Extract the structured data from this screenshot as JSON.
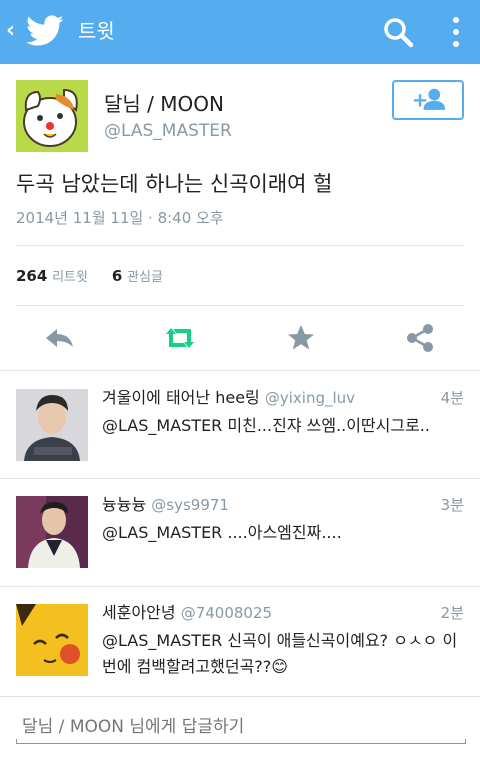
{
  "topbar": {
    "title": "트윗",
    "back_icon": "chevron-left-icon",
    "logo_icon": "twitter-bird-icon",
    "search_icon": "search-icon",
    "more_icon": "more-vertical-icon",
    "color": "#55acee"
  },
  "tweet": {
    "author_name": "달님 / MOON",
    "author_handle": "@LAS_MASTER",
    "text": "두곡 남았는데 하나는 신곡이래여 헐",
    "date": "2014년 11월 11일 · 8:40 오후",
    "retweets_count": "264",
    "retweets_label": "리트윗",
    "favorites_count": "6",
    "favorites_label": "관심글"
  },
  "actions": [
    {
      "name": "reply",
      "icon": "reply-icon"
    },
    {
      "name": "retweet",
      "icon": "retweet-icon",
      "color": "#19cf86"
    },
    {
      "name": "favorite",
      "icon": "star-icon"
    },
    {
      "name": "share",
      "icon": "share-icon"
    }
  ],
  "replies": [
    {
      "name": "겨울이에 태어난 hee링",
      "handle": "@yixing_luv",
      "time": "4분",
      "text": "@LAS_MASTER 미친...진쟈 쓰엠..이딴시그로.."
    },
    {
      "name": "늉늉늉",
      "handle": "@sys9971",
      "time": "3분",
      "text": "@LAS_MASTER ....아스엠진짜...."
    },
    {
      "name": "세훈아안녕",
      "handle": "@74008025",
      "time": "2분",
      "text": "@LAS_MASTER 신곡이 애들신곡이예요? ㅇㅅㅇ 이번에 컴백할려고했던곡??😊"
    }
  ],
  "reply_box": {
    "placeholder": "달님 / MOON 님에게 답글하기"
  }
}
